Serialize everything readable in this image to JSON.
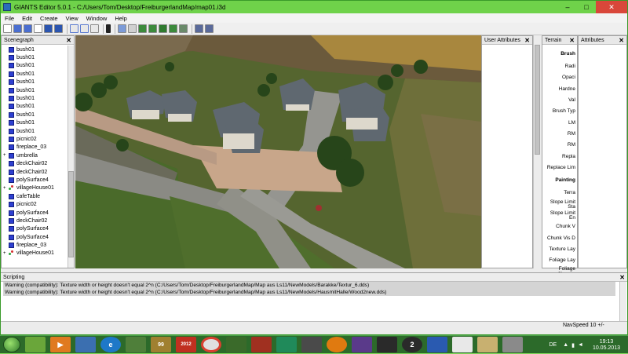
{
  "window": {
    "title": "GIANTS Editor 5.0.1 - C:/Users/Tom/Desktop/FreiburgerlandMap/map01.i3d",
    "min": "–",
    "max": "□",
    "close": "✕"
  },
  "menu": [
    {
      "label": "File"
    },
    {
      "label": "Edit"
    },
    {
      "label": "Create"
    },
    {
      "label": "View"
    },
    {
      "label": "Window"
    },
    {
      "label": "Help"
    }
  ],
  "scenegraph": {
    "title": "Scenegraph",
    "items": [
      {
        "label": "bush01",
        "icon": "cube-icon"
      },
      {
        "label": "bush01",
        "icon": "cube-icon"
      },
      {
        "label": "bush01",
        "icon": "cube-icon"
      },
      {
        "label": "bush01",
        "icon": "cube-icon"
      },
      {
        "label": "bush01",
        "icon": "cube-icon"
      },
      {
        "label": "bush01",
        "icon": "cube-icon"
      },
      {
        "label": "bush01",
        "icon": "cube-icon"
      },
      {
        "label": "bush01",
        "icon": "cube-icon"
      },
      {
        "label": "bush01",
        "icon": "cube-icon"
      },
      {
        "label": "bush01",
        "icon": "cube-icon"
      },
      {
        "label": "bush01",
        "icon": "cube-icon"
      },
      {
        "label": "picnic02",
        "icon": "cube-icon"
      },
      {
        "label": "fireplace_03",
        "icon": "cube-icon"
      },
      {
        "label": "umbrella",
        "icon": "cube-icon",
        "expander": "+"
      },
      {
        "label": "deckChair02",
        "icon": "cube-icon"
      },
      {
        "label": "deckChair02",
        "icon": "cube-icon"
      },
      {
        "label": "polySurface4",
        "icon": "cube-icon"
      },
      {
        "label": "villageHouse01",
        "icon": "group-icon",
        "expander": "+"
      },
      {
        "label": "cafeTable",
        "icon": "cube-icon"
      },
      {
        "label": "picnic02",
        "icon": "cube-icon"
      },
      {
        "label": "polySurface4",
        "icon": "cube-icon"
      },
      {
        "label": "deckChair02",
        "icon": "cube-icon"
      },
      {
        "label": "polySurface4",
        "icon": "cube-icon"
      },
      {
        "label": "polySurface4",
        "icon": "cube-icon"
      },
      {
        "label": "fireplace_03",
        "icon": "cube-icon"
      },
      {
        "label": "villageHouse01",
        "icon": "group-icon",
        "expander": "+"
      }
    ]
  },
  "user_attributes": {
    "title": "User Attributes"
  },
  "terrain": {
    "title": "Terrain",
    "brush_title": "Brush",
    "brush_items": [
      "Radi",
      "Opaci",
      "Hardne",
      "Val",
      "Brush Typ",
      "LM",
      "RM",
      "RM",
      "Repla",
      "Replace Lim"
    ],
    "painting_title": "Painting",
    "painting_items": [
      "Terra",
      "Slope Limit Sta",
      "Slope Limit En",
      "Chunk V",
      "Chunk Vis D",
      "Texture Lay",
      "Foliage Lay",
      "Foliage Channe"
    ]
  },
  "attributes": {
    "title": "Attributes"
  },
  "scripting": {
    "title": "Scripting",
    "lines": [
      "Warning (compatibility): Texture width or height doesn't equal 2^n (C:/Users/Tom/Desktop/FreiburgerlandMap/Map aus Ls11/NewModels/Barakke/Textur_6.dds)",
      "Warning (compatibility): Texture width or height doesn't equal 2^n (C:/Users/Tom/Desktop/FreiburgerlandMap/Map aus Ls11/NewModels/HausmitHalle/Wood2new.dds)"
    ]
  },
  "status": {
    "navspeed": "NavSpeed 10 +/-"
  },
  "taskbar": {
    "lang": "DE",
    "time": "19:13",
    "date": "10.05.2013",
    "badge_99": "99",
    "badge_2012": "2012"
  },
  "colors": {
    "accent": "#6fd24a",
    "close": "#d9473a",
    "taskbar": "#2c6a2a"
  }
}
